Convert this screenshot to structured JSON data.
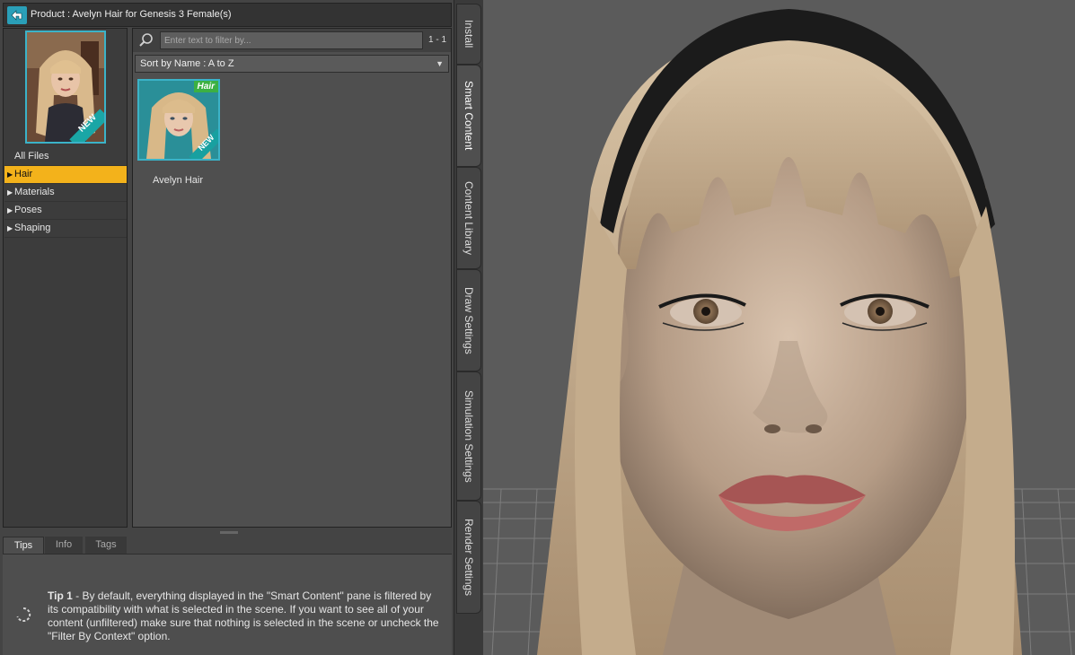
{
  "header": {
    "title": "Product :  Avelyn Hair for Genesis 3 Female(s)"
  },
  "categories": [
    {
      "label": "All Files",
      "expandable": false,
      "selected": false
    },
    {
      "label": "Hair",
      "expandable": true,
      "selected": true
    },
    {
      "label": "Materials",
      "expandable": true,
      "selected": false
    },
    {
      "label": "Poses",
      "expandable": true,
      "selected": false
    },
    {
      "label": "Shaping",
      "expandable": true,
      "selected": false
    }
  ],
  "search": {
    "placeholder": "Enter text to filter by...",
    "value": "",
    "count": "1 - 1"
  },
  "sort": {
    "label": "Sort by Name : A to Z"
  },
  "items": [
    {
      "label": "Avelyn Hair",
      "badge": "Hair",
      "ribbon": "NEW"
    }
  ],
  "thumb_large": {
    "ribbon": "NEW"
  },
  "bottom_tabs": [
    {
      "label": "Tips",
      "active": true
    },
    {
      "label": "Info",
      "active": false
    },
    {
      "label": "Tags",
      "active": false
    }
  ],
  "tip": {
    "title": "Tip 1",
    "text": " - By default, everything displayed in the \"Smart Content\" pane is filtered by its compatibility with what is selected in the scene. If you want to see all of your content (unfiltered) make sure that nothing is selected in the scene or uncheck the \"Filter By Context\" option."
  },
  "side_tabs": [
    {
      "label": "Install",
      "active": false
    },
    {
      "label": "Smart Content",
      "active": true
    },
    {
      "label": "Content Library",
      "active": false
    },
    {
      "label": "Draw Settings",
      "active": false
    },
    {
      "label": "Simulation Settings",
      "active": false
    },
    {
      "label": "Render Settings",
      "active": false
    }
  ],
  "colors": {
    "accent": "#3bb3c8",
    "selection": "#f3b21b",
    "panel": "#4f4f4f",
    "badge_green": "#3cb043"
  },
  "icons": {
    "back": "back-arrow-icon",
    "search": "search-icon",
    "sort": "dropdown-arrow-icon",
    "tip": "spinner-icon"
  }
}
